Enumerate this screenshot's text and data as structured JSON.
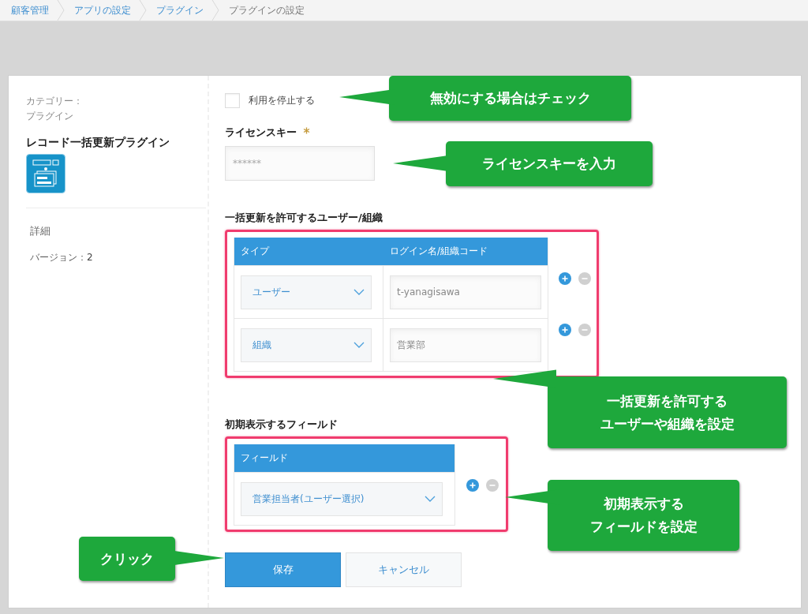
{
  "breadcrumb": [
    {
      "label": "顧客管理",
      "current": false
    },
    {
      "label": "アプリの設定",
      "current": false
    },
    {
      "label": "プラグイン",
      "current": false
    },
    {
      "label": "プラグインの設定",
      "current": true
    }
  ],
  "sidebar": {
    "category_label": "カテゴリー：",
    "category": "プラグイン",
    "plugin_name": "レコード一括更新プラグイン",
    "details_label": "詳細",
    "version_label": "バージョン：",
    "version": "2"
  },
  "form": {
    "disable_checkbox": {
      "label": "利用を停止する",
      "checked": false
    },
    "license": {
      "label": "ライセンスキー",
      "required": true,
      "placeholder": "******"
    },
    "users_section": {
      "title": "一括更新を許可するユーザー/組織",
      "highlighted": true,
      "columns": [
        "タイプ",
        "ログイン名/組織コード"
      ],
      "rows": [
        {
          "type": "ユーザー",
          "value": "t-yanagisawa"
        },
        {
          "type": "組織",
          "value": "営業部"
        }
      ]
    },
    "fields_section": {
      "title": "初期表示するフィールド",
      "highlighted": true,
      "columns": [
        "フィールド"
      ],
      "rows": [
        {
          "field": "営業担当者(ユーザー選択)"
        }
      ]
    },
    "buttons": [
      {
        "label": "保存",
        "kind": "primary"
      },
      {
        "label": "キャンセル",
        "kind": "secondary"
      }
    ]
  },
  "annotations": [
    {
      "lines": [
        "無効にする場合はチェック"
      ]
    },
    {
      "lines": [
        "ライセンスキーを入力"
      ]
    },
    {
      "lines": [
        "一括更新を許可する",
        "ユーザーや組織を設定"
      ]
    },
    {
      "lines": [
        "初期表示する",
        "フィールドを設定"
      ]
    },
    {
      "lines": [
        "クリック"
      ]
    }
  ]
}
